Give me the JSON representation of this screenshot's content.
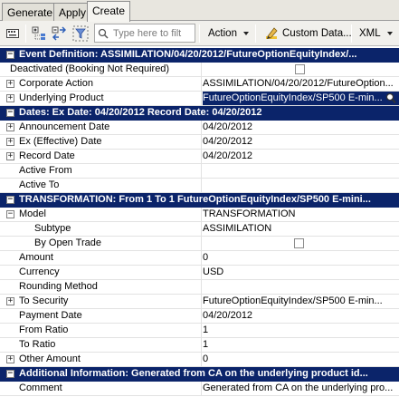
{
  "tabs": [
    "Generate",
    "Apply",
    "Create"
  ],
  "toolbar": {
    "search_placeholder": "Type here to filt",
    "action_label": "Action",
    "custom_data_label": "Custom Data...",
    "xml_label": "XML"
  },
  "sections": {
    "event": "Event Definition: ASSIMILATION/04/20/2012/FutureOptionEquityIndex/...",
    "dates": "Dates:  Ex Date: 04/20/2012 Record Date: 04/20/2012",
    "transformation": "TRANSFORMATION:  From 1 To 1 FutureOptionEquityIndex/SP500 E-mini...",
    "additional": "Additional Information: Generated from CA on the underlying product id..."
  },
  "rows": {
    "deactivated": {
      "key": "Deactivated (Booking Not Required)"
    },
    "corporate_action": {
      "key": "Corporate Action",
      "value": "ASSIMILATION/04/20/2012/FutureOption..."
    },
    "underlying_product": {
      "key": "Underlying Product",
      "value": "FutureOptionEquityIndex/SP500 E-min..."
    },
    "announcement_date": {
      "key": "Announcement Date",
      "value": "04/20/2012"
    },
    "ex_date": {
      "key": "Ex (Effective) Date",
      "value": "04/20/2012"
    },
    "record_date": {
      "key": "Record Date",
      "value": "04/20/2012"
    },
    "active_from": {
      "key": "Active From",
      "value": ""
    },
    "active_to": {
      "key": "Active To",
      "value": ""
    },
    "model": {
      "key": "Model",
      "value": "TRANSFORMATION"
    },
    "subtype": {
      "key": "Subtype",
      "value": "ASSIMILATION"
    },
    "by_open_trade": {
      "key": "By Open Trade"
    },
    "amount": {
      "key": "Amount",
      "value": "0"
    },
    "currency": {
      "key": "Currency",
      "value": "USD"
    },
    "rounding_method": {
      "key": "Rounding Method",
      "value": ""
    },
    "to_security": {
      "key": "To Security",
      "value": "FutureOptionEquityIndex/SP500 E-min..."
    },
    "payment_date": {
      "key": "Payment Date",
      "value": "04/20/2012"
    },
    "from_ratio": {
      "key": "From Ratio",
      "value": "1"
    },
    "to_ratio": {
      "key": "To Ratio",
      "value": "1"
    },
    "other_amount": {
      "key": "Other Amount",
      "value": "0"
    },
    "comment": {
      "key": "Comment",
      "value": "Generated from CA on the underlying pro..."
    }
  },
  "colors": {
    "header_bg": "#0b246a",
    "header_text": "#ffffff"
  }
}
